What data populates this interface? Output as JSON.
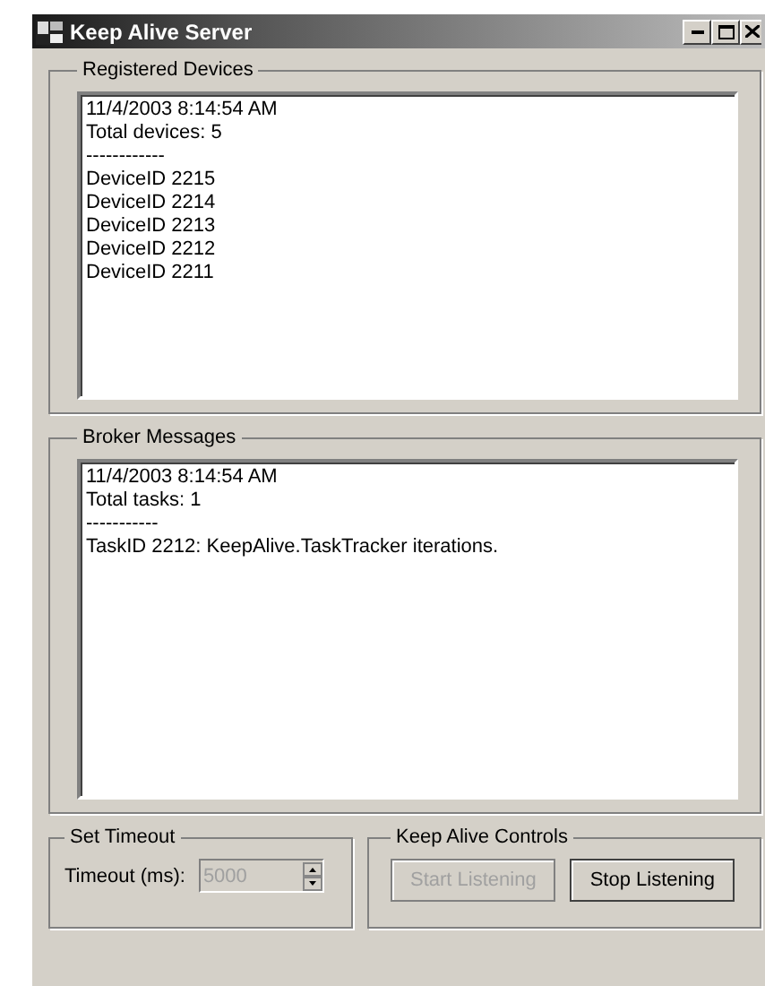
{
  "window": {
    "title": "Keep Alive Server"
  },
  "registered_devices": {
    "title": "Registered Devices",
    "lines": [
      "11/4/2003 8:14:54 AM",
      "Total devices: 5",
      "------------",
      "DeviceID 2215",
      "DeviceID 2214",
      "DeviceID 2213",
      "DeviceID 2212",
      "DeviceID 2211"
    ]
  },
  "broker_messages": {
    "title": "Broker Messages",
    "lines": [
      "11/4/2003 8:14:54 AM",
      "Total tasks: 1",
      "-----------",
      "TaskID 2212: KeepAlive.TaskTracker iterations."
    ]
  },
  "set_timeout": {
    "title": "Set Timeout",
    "label": "Timeout (ms):",
    "value": "5000",
    "disabled": true
  },
  "keep_alive_controls": {
    "title": "Keep Alive Controls",
    "buttons": [
      {
        "label": "Start Listening",
        "disabled": true
      },
      {
        "label": "Stop Listening",
        "disabled": false
      }
    ]
  }
}
